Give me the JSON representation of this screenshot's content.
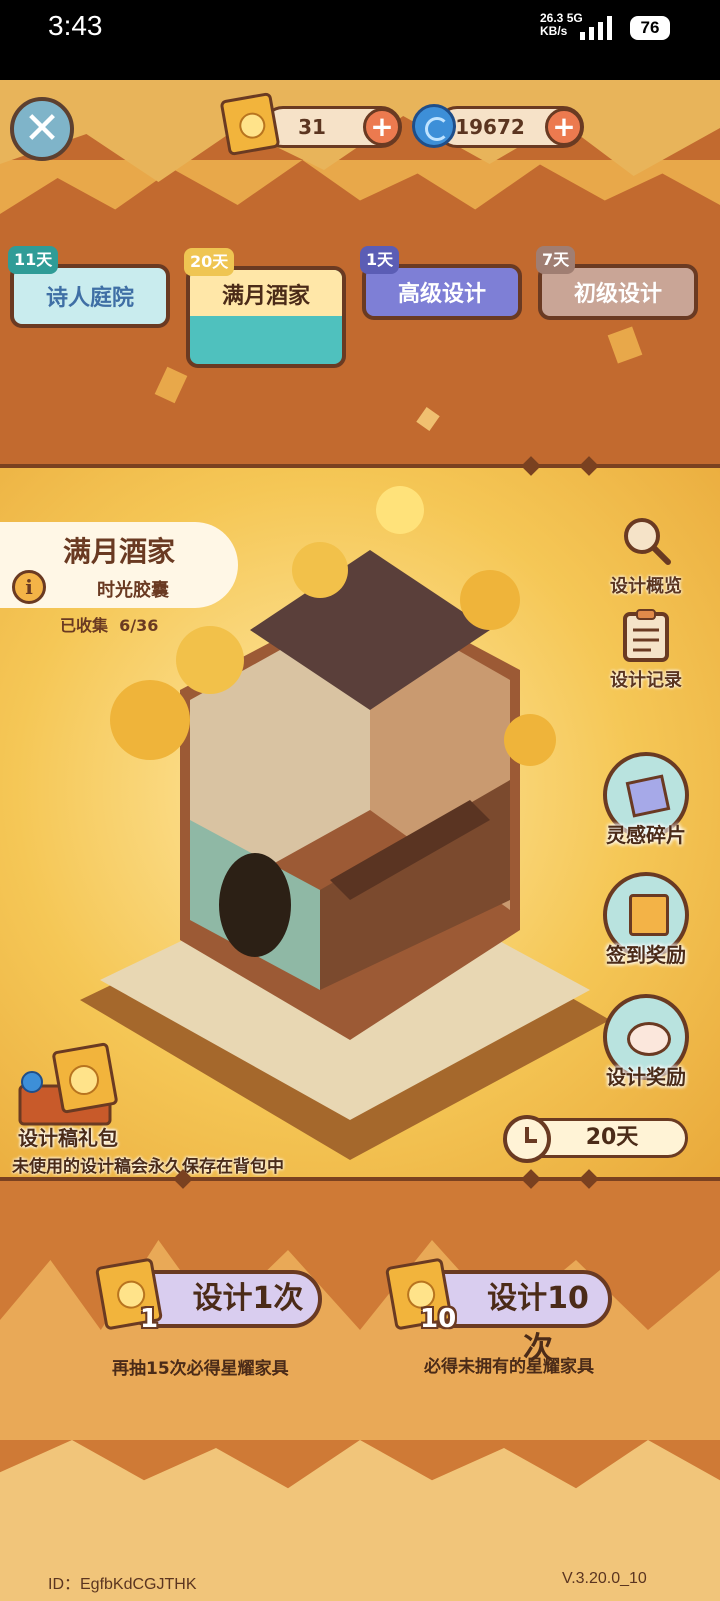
{
  "status_bar": {
    "time": "3:43",
    "net_speed": "26.3",
    "net_unit": "KB/s",
    "net_type": "5G",
    "battery": "76"
  },
  "currency": {
    "scrolls": "31",
    "crystals": "19672"
  },
  "tabs": [
    {
      "days": "11天",
      "label": "诗人庭院"
    },
    {
      "days": "20天",
      "label": "满月酒家"
    },
    {
      "days": "1天",
      "label": "高级设计"
    },
    {
      "days": "7天",
      "label": "初级设计"
    }
  ],
  "set": {
    "title": "满月酒家",
    "subtitle": "时光胶囊",
    "collected_label": "已收集",
    "collected": "6/36"
  },
  "side_menu": {
    "overview": "设计概览",
    "records": "设计记录",
    "inspiration": "灵感碎片",
    "checkin": "签到奖励",
    "design_reward": "设计奖励"
  },
  "gift": {
    "label": "设计稿礼包",
    "note": "未使用的设计稿会永久保存在背包中"
  },
  "timer": "20天",
  "pull": {
    "single": {
      "count": "1",
      "label": "设计1次",
      "note": "再抽15次必得星耀家具"
    },
    "multi": {
      "count": "10",
      "label": "设计10次",
      "note": "必得未拥有的星耀家具"
    }
  },
  "footer": {
    "id": "ID：EgfbKdCGJTHK",
    "version": "V.3.20.0_10"
  },
  "colors": {
    "brown": "#6a3a22",
    "orange": "#c26a2f",
    "gold": "#f5c756"
  }
}
